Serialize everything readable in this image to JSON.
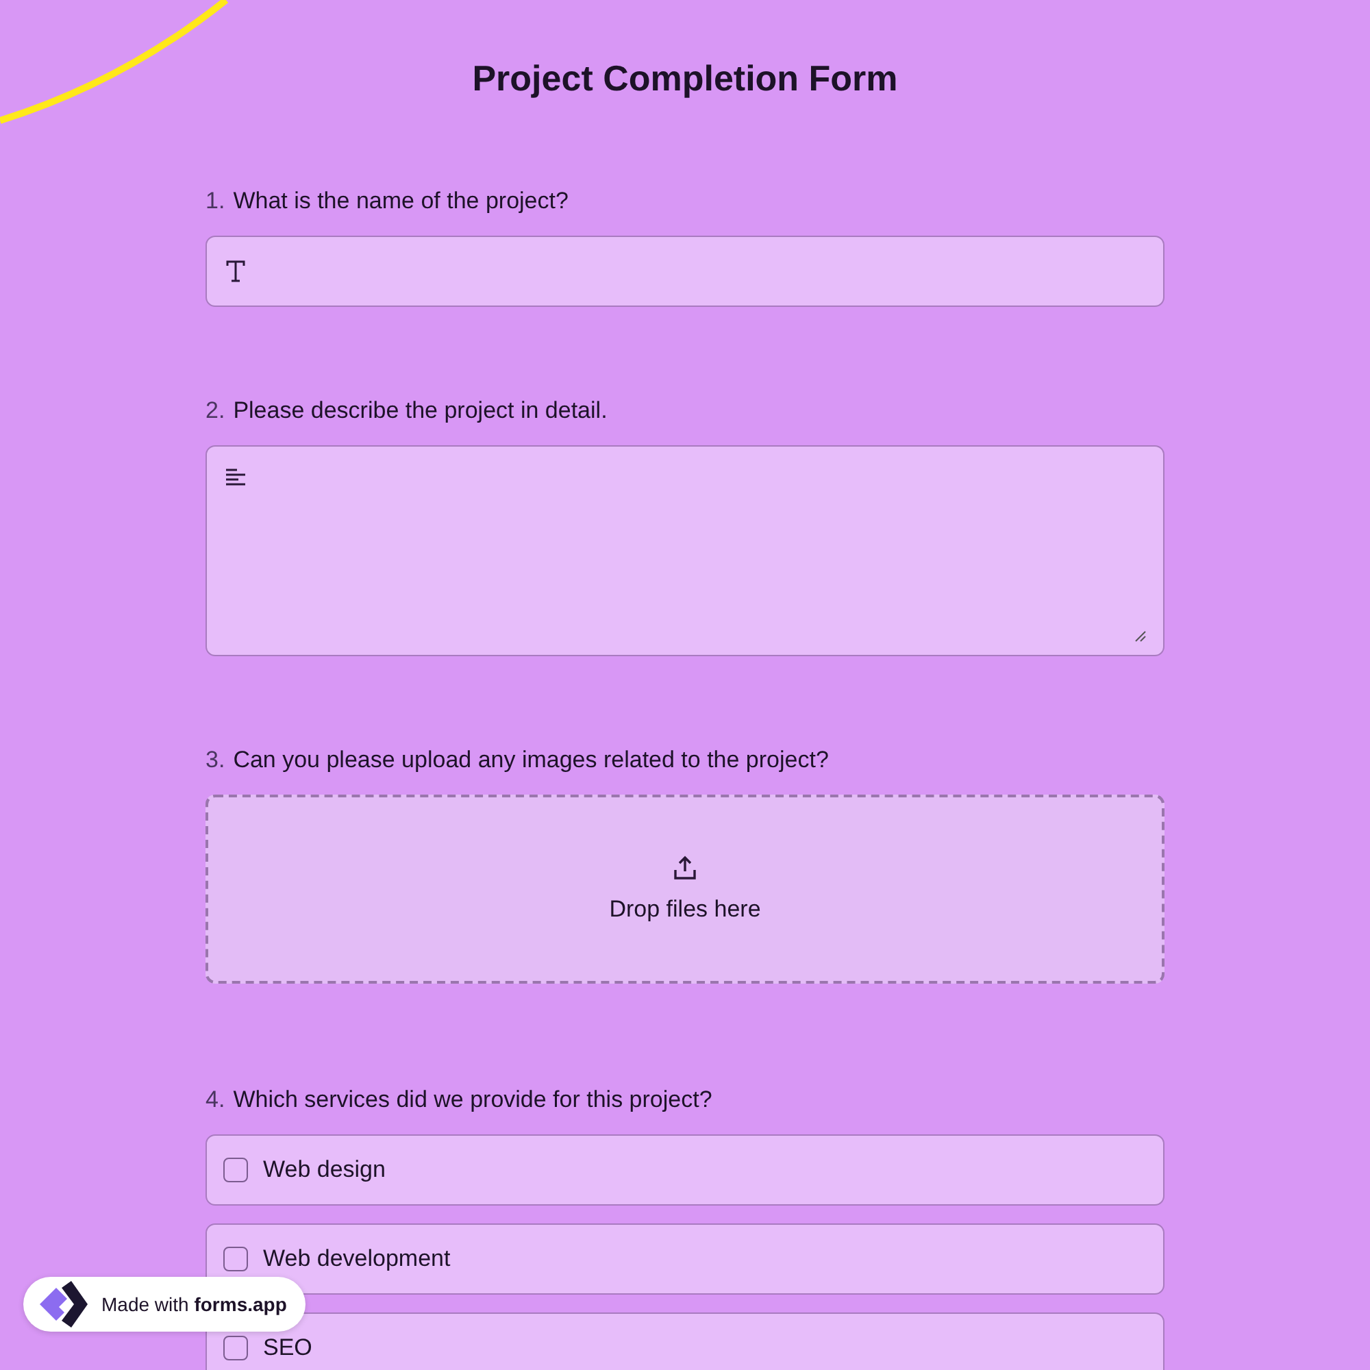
{
  "title": "Project Completion Form",
  "questions": [
    {
      "number": "1.",
      "label": "What is the name of the project?",
      "kind": "text"
    },
    {
      "number": "2.",
      "label": "Please describe the project in detail.",
      "kind": "textarea"
    },
    {
      "number": "3.",
      "label": "Can you please upload any images related to the project?",
      "kind": "upload",
      "drop_text": "Drop files here"
    },
    {
      "number": "4.",
      "label": "Which services did we provide for this project?",
      "kind": "checkboxes",
      "options": [
        {
          "label": "Web design",
          "checked": false
        },
        {
          "label": "Web development",
          "checked": false
        },
        {
          "label": "SEO",
          "checked": false
        }
      ]
    }
  ],
  "badge": {
    "prefix": "Made with",
    "brand": "forms.app"
  }
}
